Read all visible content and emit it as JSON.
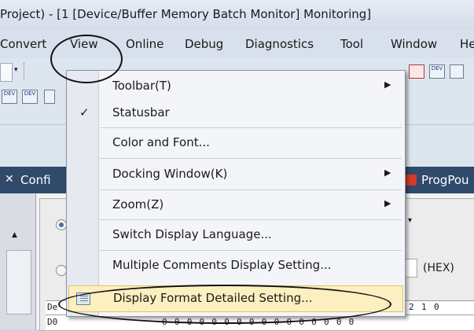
{
  "window": {
    "title": "Project) - [1 [Device/Buffer Memory Batch Monitor] Monitoring]"
  },
  "menubar": {
    "items": [
      "Convert",
      "View",
      "Online",
      "Debug",
      "Diagnostics",
      "Tool",
      "Window",
      "He"
    ]
  },
  "toolbar": {
    "dev_label": "DEV"
  },
  "tabs": {
    "left": "Confi",
    "right": "ProgPou"
  },
  "view_menu": {
    "items": [
      {
        "label": "Toolbar(T)",
        "submenu": true,
        "checked": false
      },
      {
        "label": "Statusbar",
        "submenu": false,
        "checked": true
      },
      {
        "label": "Color and Font...",
        "submenu": false,
        "checked": false
      },
      {
        "label": "Docking Window(K)",
        "submenu": true,
        "checked": false
      },
      {
        "label": "Zoom(Z)",
        "submenu": true,
        "checked": false
      },
      {
        "label": "Switch Display Language...",
        "submenu": false,
        "checked": false
      },
      {
        "label": "Multiple Comments Display Setting...",
        "submenu": false,
        "checked": false
      },
      {
        "label": "Display Format Detailed Setting...",
        "submenu": false,
        "checked": false,
        "highlighted": true
      }
    ],
    "checkmark": "✓",
    "submenu_arrow": "▶"
  },
  "monitor": {
    "hex_label": "(HEX)",
    "header_device": "De",
    "header_bits": [
      "2",
      "1",
      "0"
    ],
    "row_device": "D0",
    "row_bits": "0 0 0 0 0 0 0 0 0 0 0 0 0 0 0 0"
  },
  "colors": {
    "menu_highlight": "#fcefc0",
    "tab_bar": "#304a6b"
  },
  "icons": [
    "checkmark-icon",
    "submenu-arrow-icon",
    "display-format-icon",
    "progpou-icon"
  ]
}
